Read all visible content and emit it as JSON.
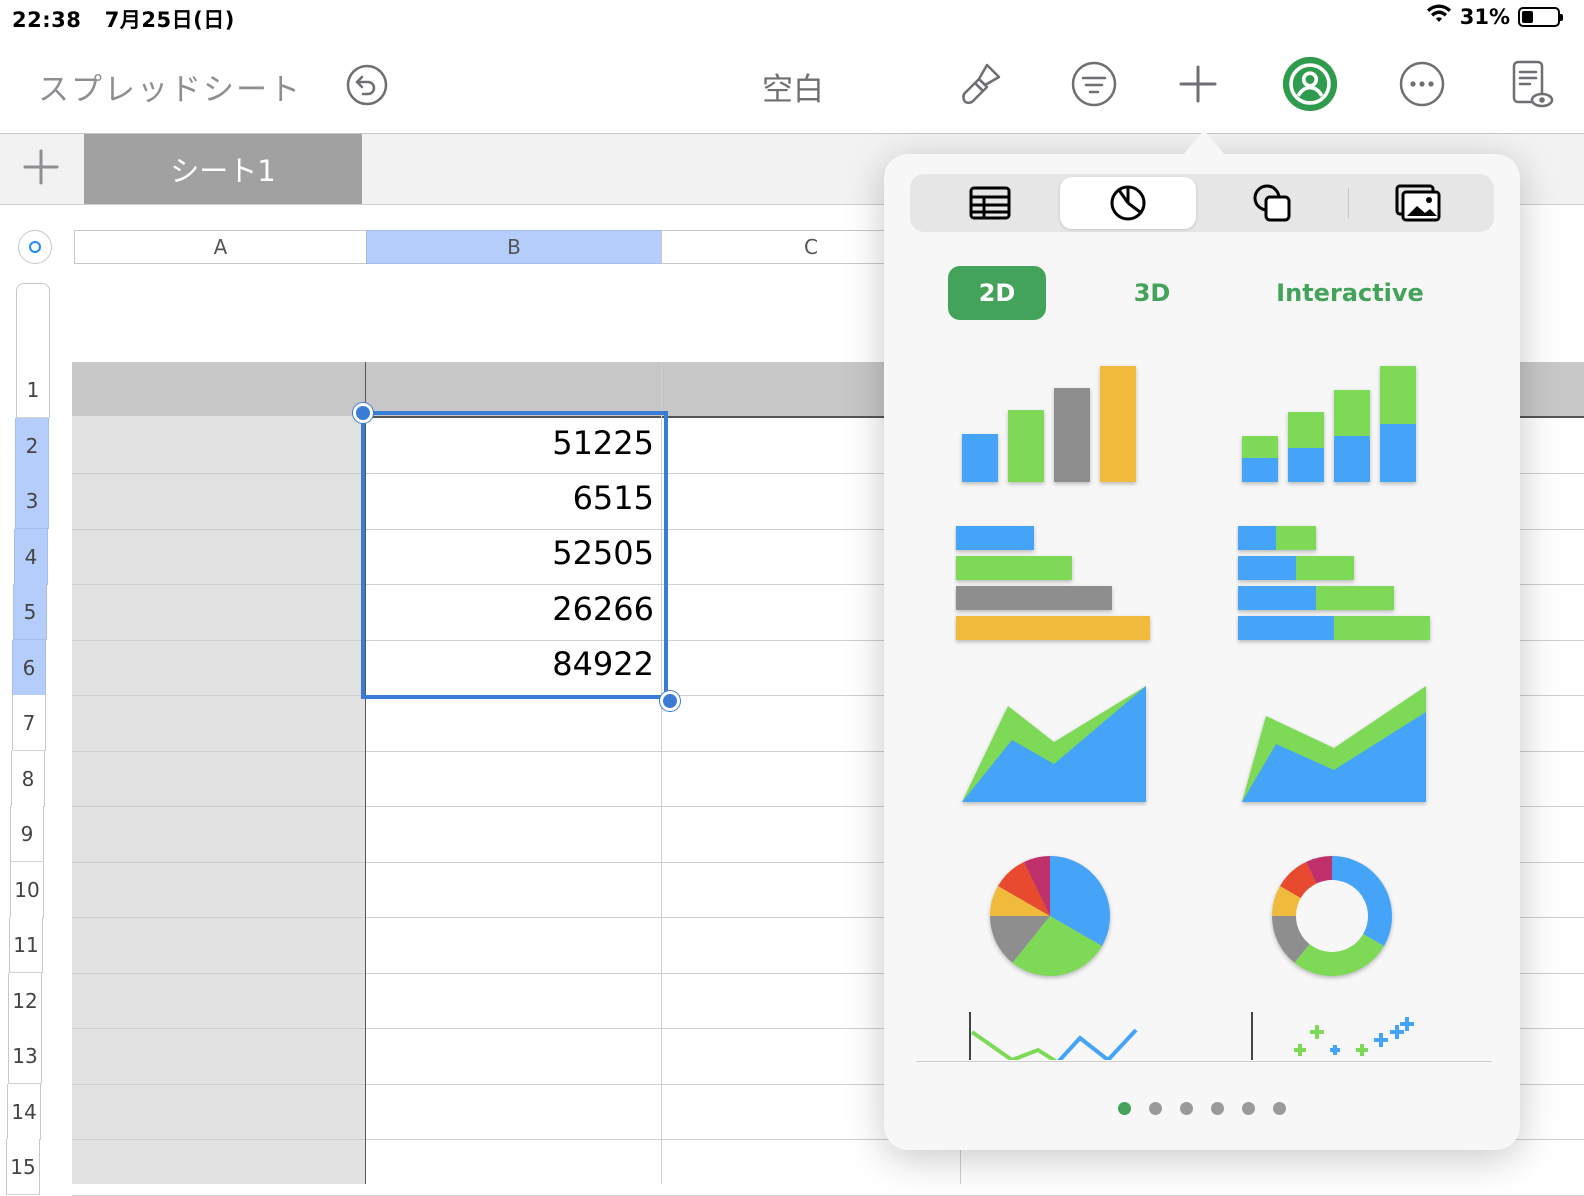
{
  "status_bar": {
    "time": "22:38",
    "date": "7月25日(日)",
    "battery": "31%",
    "battery_level": 0.31
  },
  "toolbar": {
    "back_label": "スプレッドシート",
    "document_title": "空白",
    "icons": [
      "undo-icon",
      "paintbrush-icon",
      "filter-icon",
      "plus-icon",
      "collaborate-icon",
      "more-icon",
      "reading-view-icon"
    ]
  },
  "sheets": {
    "tabs": [
      {
        "label": "シート1"
      }
    ]
  },
  "grid": {
    "columns": [
      "A",
      "B",
      "C"
    ],
    "selected_column": "B",
    "rows": [
      "1",
      "2",
      "3",
      "4",
      "5",
      "6",
      "7",
      "8",
      "9",
      "10",
      "11",
      "12",
      "13",
      "14",
      "15"
    ],
    "selected_rows": [
      "2",
      "3",
      "4",
      "5",
      "6"
    ],
    "column_b_values": [
      "51225",
      "6515",
      "52505",
      "26266",
      "84922"
    ]
  },
  "chart_popover": {
    "tabs": [
      "table-icon",
      "chart-icon",
      "shapes-icon",
      "media-icon"
    ],
    "active_tab": "chart-icon",
    "filters": [
      "2D",
      "3D",
      "Interactive"
    ],
    "active_filter": "2D",
    "thumbnails": [
      "column-chart",
      "stacked-column-chart",
      "bar-chart",
      "stacked-bar-chart",
      "area-chart",
      "stacked-area-chart",
      "pie-chart",
      "donut-chart",
      "line-chart",
      "scatter-chart"
    ],
    "page_count": 6,
    "current_page": 1,
    "colors": {
      "blue": "#45a4f8",
      "green": "#7ed957",
      "gray": "#8e8e8e",
      "yellow": "#f0bb3c",
      "red": "#e84a2f",
      "magenta": "#c0306b",
      "accent": "#43a35a"
    }
  }
}
